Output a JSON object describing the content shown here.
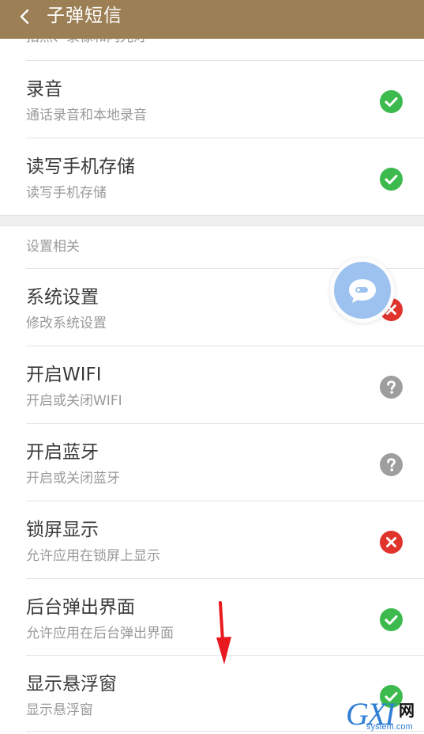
{
  "header": {
    "title": "子弹短信"
  },
  "top_cut_text": "拍照、录像和闪光灯",
  "group1": [
    {
      "title": "录音",
      "subtitle": "通话录音和本地录音",
      "status": "granted"
    },
    {
      "title": "读写手机存储",
      "subtitle": "读写手机存储",
      "status": "granted"
    }
  ],
  "section2": {
    "label": "设置相关",
    "items": [
      {
        "title": "系统设置",
        "subtitle": "修改系统设置",
        "status": "denied"
      },
      {
        "title": "开启WIFI",
        "subtitle": "开启或关闭WIFI",
        "status": "unknown"
      },
      {
        "title": "开启蓝牙",
        "subtitle": "开启或关闭蓝牙",
        "status": "unknown"
      },
      {
        "title": "锁屏显示",
        "subtitle": "允许应用在锁屏上显示",
        "status": "denied"
      },
      {
        "title": "后台弹出界面",
        "subtitle": "允许应用在后台弹出界面",
        "status": "granted"
      },
      {
        "title": "显示悬浮窗",
        "subtitle": "显示悬浮窗",
        "status": "granted"
      }
    ]
  },
  "colors": {
    "header_bg": "#9c7f54",
    "granted": "#3dba4e",
    "denied": "#e0332c",
    "unknown": "#9e9e9e",
    "float_button": "#9ec2f0",
    "arrow": "#e8191f"
  },
  "watermark": {
    "brand": "GXI",
    "net": "网",
    "domain": "system.com"
  }
}
